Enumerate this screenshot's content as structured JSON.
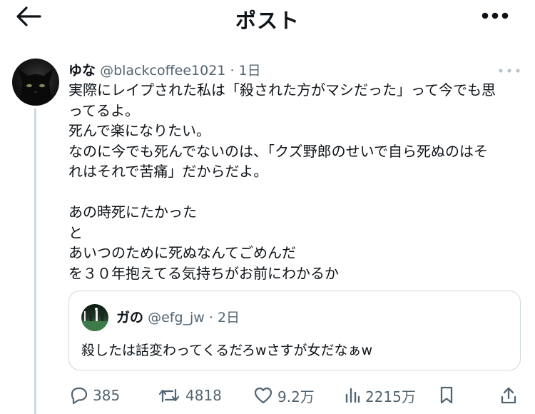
{
  "header": {
    "title": "ポスト",
    "back_icon": "arrow-left-icon",
    "more_icon": "more-horizontal-icon"
  },
  "post": {
    "author_name": "ゆな",
    "author_handle": "@blackcoffee1021",
    "separator": "·",
    "time": "1日",
    "more_icon": "more-horizontal-icon",
    "lines": [
      "実際にレイプされた私は「殺された方がマシだった」って今でも思",
      "ってるよ。",
      "死んで楽になりたい。",
      "なのに今でも死んでないのは、「クズ野郎のせいで自ら死ぬのはそ",
      "れはそれで苦痛」だからだよ。",
      "",
      "あの時死にたかった",
      "と",
      "あいつのために死ぬなんてごめんだ",
      "を３０年抱えてる気持ちがお前にわかるか"
    ]
  },
  "quote": {
    "author_name": "ガの",
    "author_handle": "@efg_jw",
    "separator": "·",
    "time": "2日",
    "text": "殺したは話変わってくるだろwさすが女だなぁw"
  },
  "actions": {
    "reply_count": "385",
    "repost_count": "4818",
    "like_count": "9.2万",
    "views_count": "2215万",
    "reply_icon": "reply-bubble-icon",
    "repost_icon": "repost-icon",
    "like_icon": "heart-icon",
    "views_icon": "views-chart-icon",
    "bookmark_icon": "bookmark-icon",
    "share_icon": "share-icon"
  },
  "colors": {
    "text": "#0f1419",
    "secondary": "#536471",
    "border": "#cfd9de",
    "background": "#ffffff"
  }
}
